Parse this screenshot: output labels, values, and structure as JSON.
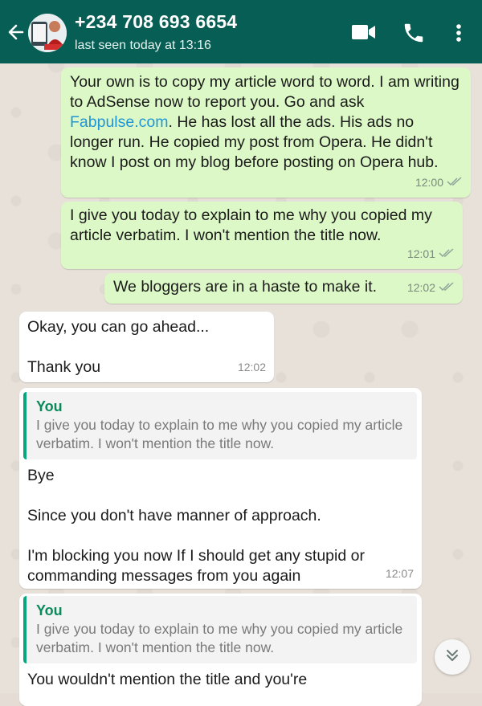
{
  "header": {
    "contact_name": "+234 708 693 6654",
    "status": "last seen today at 13:16",
    "icons": [
      "back-arrow-icon",
      "video-call-icon",
      "voice-call-icon",
      "more-options-icon"
    ]
  },
  "colors": {
    "header": "#075e54",
    "outgoing_bubble": "#dcf8c6",
    "incoming_bubble": "#ffffff",
    "link": "#2196d6",
    "quote_bar": "#06a77d"
  },
  "messages": [
    {
      "direction": "out",
      "text_before_link": "Your own is to copy my article word to word. I am writing to AdSense now to report you. Go and ask ",
      "link": "Fabpulse.com",
      "text_after_link": ". He has lost all the ads. His ads no longer run. He copied my post from Opera. He didn't know I post on my blog before posting on Opera hub.",
      "time": "12:00",
      "status": "read"
    },
    {
      "direction": "out",
      "text": "I give you today to explain to me why you copied my article verbatim. I won't mention the title now.",
      "time": "12:01",
      "status": "read"
    },
    {
      "direction": "out",
      "text": "We bloggers are in a haste to make it.",
      "time": "12:02",
      "status": "read"
    },
    {
      "direction": "in",
      "text": "Okay, you can go ahead...\n\nThank you",
      "time": "12:02"
    },
    {
      "direction": "in",
      "quote": {
        "author": "You",
        "text": "I give you today to explain to me why you copied my article verbatim. I won't mention the title now."
      },
      "text": "Bye\n\nSince you don't have manner of approach.\n\nI'm blocking you now If I should get any stupid or commanding messages from you again",
      "time": "12:07"
    },
    {
      "direction": "in",
      "quote": {
        "author": "You",
        "text": "I give you today to explain to me why you copied my article verbatim. I won't mention the title now."
      },
      "text": "You wouldn't mention the title and you're"
    }
  ]
}
